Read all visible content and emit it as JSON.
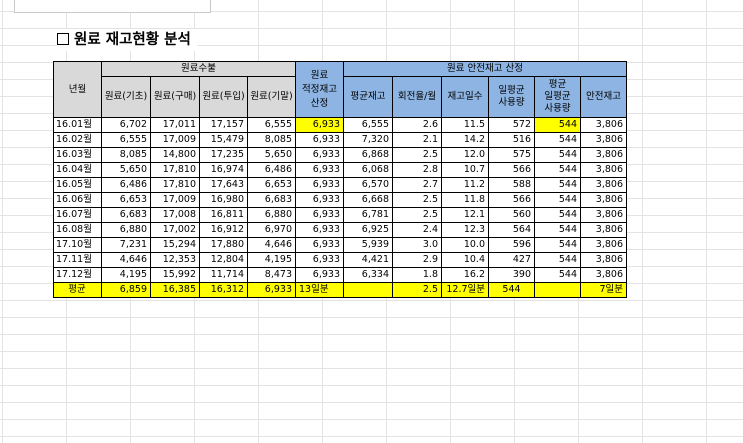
{
  "title": "원료 재고현황 분석",
  "headers": {
    "month": "년월",
    "group_supply": "원료수불",
    "col_base": "원료(기초)",
    "col_purchase": "원료(구매)",
    "col_input": "원료(투입)",
    "col_end": "원료(기말)",
    "proper_line1": "원료",
    "proper_line2": "적정재고",
    "proper_line3": "산정",
    "group_safety": "원료 안전재고 산정",
    "col_avg_stock": "평균재고",
    "col_turnover": "회전율/월",
    "col_stock_days": "재고일수",
    "daily_line1": "일평균",
    "daily_line2": "사용량",
    "avg_daily_line1": "평균",
    "avg_daily_line2": "일평균",
    "avg_daily_line3": "사용량",
    "col_safety": "안전재고"
  },
  "rows": [
    [
      "16.01월",
      "6,702",
      "17,011",
      "17,157",
      "6,555",
      "6,933",
      "6,555",
      "2.6",
      "11.5",
      "572",
      "544",
      "3,806"
    ],
    [
      "16.02월",
      "6,555",
      "17,009",
      "15,479",
      "8,085",
      "6,933",
      "7,320",
      "2.1",
      "14.2",
      "516",
      "544",
      "3,806"
    ],
    [
      "16.03월",
      "8,085",
      "14,800",
      "17,235",
      "5,650",
      "6,933",
      "6,868",
      "2.5",
      "12.0",
      "575",
      "544",
      "3,806"
    ],
    [
      "16.04월",
      "5,650",
      "17,810",
      "16,974",
      "6,486",
      "6,933",
      "6,068",
      "2.8",
      "10.7",
      "566",
      "544",
      "3,806"
    ],
    [
      "16.05월",
      "6,486",
      "17,810",
      "17,643",
      "6,653",
      "6,933",
      "6,570",
      "2.7",
      "11.2",
      "588",
      "544",
      "3,806"
    ],
    [
      "16.06월",
      "6,653",
      "17,009",
      "16,980",
      "6,683",
      "6,933",
      "6,668",
      "2.5",
      "11.8",
      "566",
      "544",
      "3,806"
    ],
    [
      "16.07월",
      "6,683",
      "17,008",
      "16,811",
      "6,880",
      "6,933",
      "6,781",
      "2.5",
      "12.1",
      "560",
      "544",
      "3,806"
    ],
    [
      "16.08월",
      "6,880",
      "17,002",
      "16,912",
      "6,970",
      "6,933",
      "6,925",
      "2.4",
      "12.3",
      "564",
      "544",
      "3,806"
    ],
    [
      "17.10월",
      "7,231",
      "15,294",
      "17,880",
      "4,646",
      "6,933",
      "5,939",
      "3.0",
      "10.0",
      "596",
      "544",
      "3,806"
    ],
    [
      "17.11월",
      "4,646",
      "12,353",
      "12,804",
      "4,195",
      "6,933",
      "4,421",
      "2.9",
      "10.4",
      "427",
      "544",
      "3,806"
    ],
    [
      "17.12월",
      "4,195",
      "15,992",
      "11,714",
      "8,473",
      "6,933",
      "6,334",
      "1.8",
      "16.2",
      "390",
      "544",
      "3,806"
    ]
  ],
  "average": [
    "평균",
    "6,859",
    "16,385",
    "16,312",
    "6,933",
    "13일분",
    "",
    "2.5",
    "12.7일분",
    "544",
    "",
    "7일분"
  ],
  "colors": {
    "header_gray": "#d9d9d9",
    "header_blue": "#8db4e2",
    "highlight_yellow": "#ffff00"
  }
}
